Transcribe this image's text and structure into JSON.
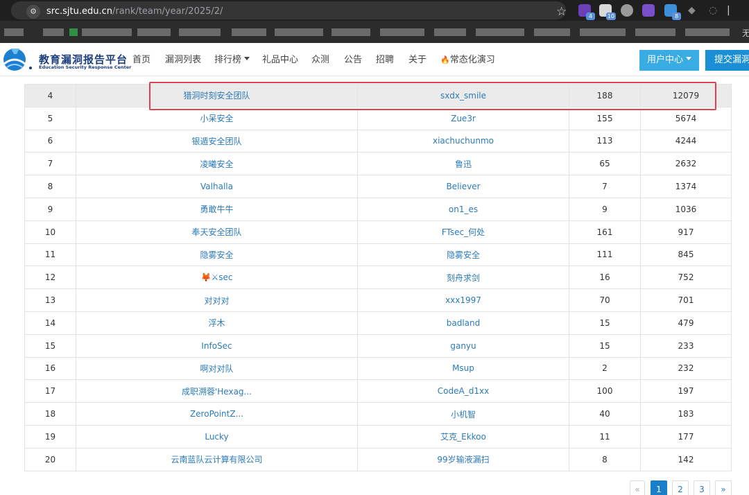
{
  "browser": {
    "url_host": "src.sjtu.edu.cn",
    "url_path": "/rank/team/year/2025/2/",
    "extension_badges": [
      "4",
      "10",
      "8"
    ],
    "bookmarks_edge_text": "无"
  },
  "site": {
    "logo_title": "教育漏洞报告平台",
    "logo_subtitle": "Education Security Response Center",
    "nav": {
      "home": "首页",
      "vuln_list": "漏洞列表",
      "ranking": "排行榜",
      "gift_center": "礼品中心",
      "crowd_test": "众测",
      "notice": "公告",
      "recruit": "招聘",
      "about": "关于",
      "drill": "常态化演习"
    },
    "user_center": "用户中心",
    "submit_vuln": "提交漏洞"
  },
  "ranking": {
    "rows": [
      {
        "rank": "4",
        "team": "猎洞时刻安全团队",
        "leader": "sxdx_smile",
        "count": "188",
        "score": "12079"
      },
      {
        "rank": "5",
        "team": "小呆安全",
        "leader": "Zue3r",
        "count": "155",
        "score": "5674"
      },
      {
        "rank": "6",
        "team": "银遁安全团队",
        "leader": "xiachuchunmo",
        "count": "113",
        "score": "4244"
      },
      {
        "rank": "7",
        "team": "凌曦安全",
        "leader": "鲁迅",
        "count": "65",
        "score": "2632"
      },
      {
        "rank": "8",
        "team": "Valhalla",
        "leader": "Believer",
        "count": "7",
        "score": "1374"
      },
      {
        "rank": "9",
        "team": "勇敢牛牛",
        "leader": "on1_es",
        "count": "9",
        "score": "1036"
      },
      {
        "rank": "10",
        "team": "奉天安全团队",
        "leader": "FTsec_何处",
        "count": "161",
        "score": "917"
      },
      {
        "rank": "11",
        "team": "隐雾安全",
        "leader": "隐雾安全",
        "count": "111",
        "score": "845"
      },
      {
        "rank": "12",
        "team": "🦊⚔sec",
        "leader": "刻舟求剑",
        "count": "16",
        "score": "752"
      },
      {
        "rank": "13",
        "team": "对对对",
        "leader": "xxx1997",
        "count": "70",
        "score": "701"
      },
      {
        "rank": "14",
        "team": "浮木",
        "leader": "badland",
        "count": "15",
        "score": "479"
      },
      {
        "rank": "15",
        "team": "InfoSec",
        "leader": "ganyu",
        "count": "15",
        "score": "233"
      },
      {
        "rank": "16",
        "team": "啊对对队",
        "leader": "Msup",
        "count": "2",
        "score": "232"
      },
      {
        "rank": "17",
        "team": "成职溯蓉'Hexag...",
        "leader": "CodeA_d1xx",
        "count": "100",
        "score": "197"
      },
      {
        "rank": "18",
        "team": "ZeroPointZ...",
        "leader": "小机智",
        "count": "40",
        "score": "183"
      },
      {
        "rank": "19",
        "team": "Lucky",
        "leader": "艾克_Ekkoo",
        "count": "11",
        "score": "177"
      },
      {
        "rank": "20",
        "team": "云南蓝队云计算有限公司",
        "leader": "99岁输液漏扫",
        "count": "8",
        "score": "142"
      }
    ]
  },
  "pagination": {
    "prev": "«",
    "pages": [
      "1",
      "2",
      "3"
    ],
    "next": "»",
    "current": "1"
  },
  "colors": {
    "link": "#2b7bb9",
    "highlight": "#e0434f",
    "user_center_bg": "#3aace4",
    "submit_bg": "#1a8fd6",
    "active_page": "#1a7fc9"
  }
}
